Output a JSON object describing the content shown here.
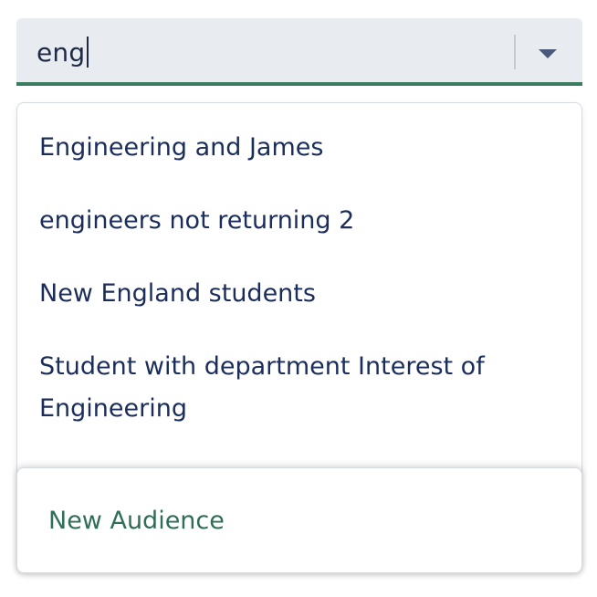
{
  "search": {
    "value": "eng"
  },
  "dropdown": {
    "options": [
      {
        "label": "Engineering and James"
      },
      {
        "label": "engineers not returning 2"
      },
      {
        "label": "New England students"
      },
      {
        "label": "Student with department Interest of Engineering"
      }
    ]
  },
  "actions": {
    "new_audience_label": "New Audience"
  },
  "colors": {
    "accent": "#3d7a62",
    "option_text": "#1b2d5a",
    "input_bg": "#e8ebf0"
  },
  "icons": {
    "dropdown": "chevron-down-icon"
  }
}
